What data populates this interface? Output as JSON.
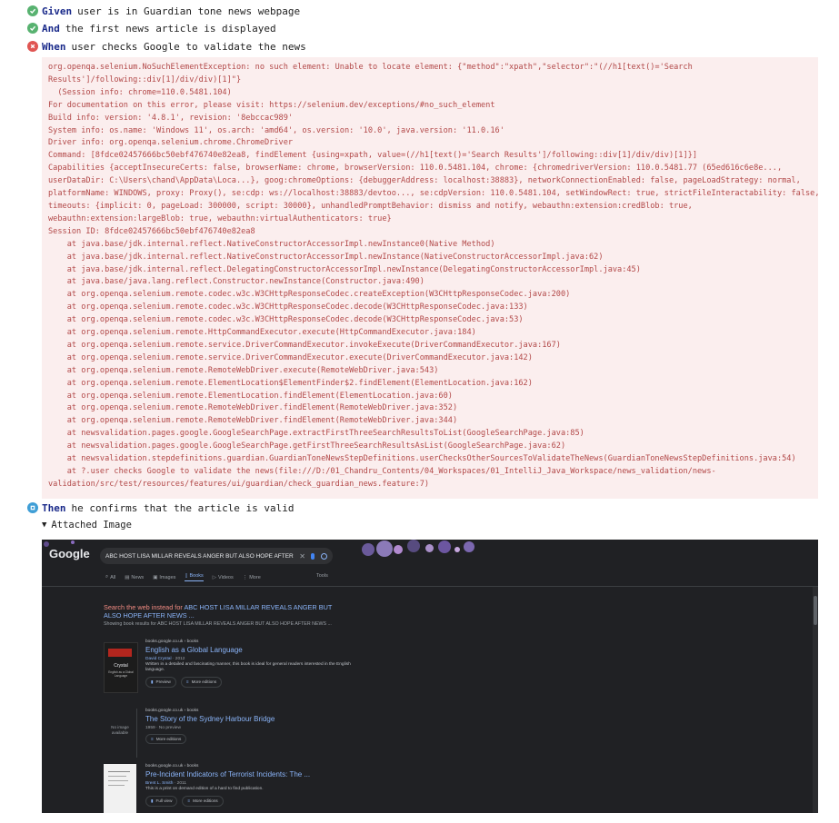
{
  "steps": [
    {
      "status": "pass",
      "keyword": "Given",
      "text": "user is in Guardian tone news webpage"
    },
    {
      "status": "pass",
      "keyword": "And",
      "text": "the first news article is displayed"
    },
    {
      "status": "fail",
      "keyword": "When",
      "text": "user checks Google to validate the news"
    },
    {
      "status": "info",
      "keyword": "Then",
      "text": "he confirms that the article is valid"
    }
  ],
  "error_lines": [
    "org.openqa.selenium.NoSuchElementException: no such element: Unable to locate element: {\"method\":\"xpath\",\"selector\":\"(//h1[text()='Search",
    "Results']/following::div[1]/div/div)[1]\"}",
    "  (Session info: chrome=110.0.5481.104)",
    "For documentation on this error, please visit: https://selenium.dev/exceptions/#no_such_element",
    "Build info: version: '4.8.1', revision: '8ebccac989'",
    "System info: os.name: 'Windows 11', os.arch: 'amd64', os.version: '10.0', java.version: '11.0.16'",
    "Driver info: org.openqa.selenium.chrome.ChromeDriver",
    "Command: [8fdce02457666bc50ebf476740e82ea8, findElement {using=xpath, value=(//h1[text()='Search Results']/following::div[1]/div/div)[1]}]",
    "Capabilities {acceptInsecureCerts: false, browserName: chrome, browserVersion: 110.0.5481.104, chrome: {chromedriverVersion: 110.0.5481.77 (65ed616c6e8e...,",
    "userDataDir: C:\\Users\\chand\\AppData\\Loca...}, goog:chromeOptions: {debuggerAddress: localhost:38883}, networkConnectionEnabled: false, pageLoadStrategy: normal,",
    "platformName: WINDOWS, proxy: Proxy(), se:cdp: ws://localhost:38883/devtoo..., se:cdpVersion: 110.0.5481.104, setWindowRect: true, strictFileInteractability: false,",
    "timeouts: {implicit: 0, pageLoad: 300000, script: 30000}, unhandledPromptBehavior: dismiss and notify, webauthn:extension:credBlob: true,",
    "webauthn:extension:largeBlob: true, webauthn:virtualAuthenticators: true}",
    "Session ID: 8fdce02457666bc50ebf476740e82ea8",
    "    at java.base/jdk.internal.reflect.NativeConstructorAccessorImpl.newInstance0(Native Method)",
    "    at java.base/jdk.internal.reflect.NativeConstructorAccessorImpl.newInstance(NativeConstructorAccessorImpl.java:62)",
    "    at java.base/jdk.internal.reflect.DelegatingConstructorAccessorImpl.newInstance(DelegatingConstructorAccessorImpl.java:45)",
    "    at java.base/java.lang.reflect.Constructor.newInstance(Constructor.java:490)",
    "    at org.openqa.selenium.remote.codec.w3c.W3CHttpResponseCodec.createException(W3CHttpResponseCodec.java:200)",
    "    at org.openqa.selenium.remote.codec.w3c.W3CHttpResponseCodec.decode(W3CHttpResponseCodec.java:133)",
    "    at org.openqa.selenium.remote.codec.w3c.W3CHttpResponseCodec.decode(W3CHttpResponseCodec.java:53)",
    "    at org.openqa.selenium.remote.HttpCommandExecutor.execute(HttpCommandExecutor.java:184)",
    "    at org.openqa.selenium.remote.service.DriverCommandExecutor.invokeExecute(DriverCommandExecutor.java:167)",
    "    at org.openqa.selenium.remote.service.DriverCommandExecutor.execute(DriverCommandExecutor.java:142)",
    "    at org.openqa.selenium.remote.RemoteWebDriver.execute(RemoteWebDriver.java:543)",
    "    at org.openqa.selenium.remote.ElementLocation$ElementFinder$2.findElement(ElementLocation.java:162)",
    "    at org.openqa.selenium.remote.ElementLocation.findElement(ElementLocation.java:60)",
    "    at org.openqa.selenium.remote.RemoteWebDriver.findElement(RemoteWebDriver.java:352)",
    "    at org.openqa.selenium.remote.RemoteWebDriver.findElement(RemoteWebDriver.java:344)",
    "    at newsvalidation.pages.google.GoogleSearchPage.extractFirstThreeSearchResultsToList(GoogleSearchPage.java:85)",
    "    at newsvalidation.pages.google.GoogleSearchPage.getFirstThreeSearchResultsAsList(GoogleSearchPage.java:62)",
    "    at newsvalidation.stepdefinitions.guardian.GuardianToneNewsStepDefinitions.userChecksOtherSourcesToValidateTheNews(GuardianToneNewsStepDefinitions.java:54)",
    "    at ?.user checks Google to validate the news(file:///D:/01_Chandru_Contents/04_Workspaces/01_IntelliJ_Java_Workspace/news_validation/news-",
    "validation/src/test/resources/features/ui/guardian/check_guardian_news.feature:7)"
  ],
  "attachment": {
    "label": "Attached Image"
  },
  "screenshot": {
    "logo": "Google",
    "query": "ABC HOST LISA MILLAR REVEALS ANGER BUT ALSO HOPE AFTER NE",
    "tabs": [
      {
        "label": "All",
        "active": false
      },
      {
        "label": "News",
        "active": false
      },
      {
        "label": "Images",
        "active": false
      },
      {
        "label": "Books",
        "active": true
      },
      {
        "label": "Videos",
        "active": false
      },
      {
        "label": "More",
        "active": false
      }
    ],
    "tools": "Tools",
    "suggest_prefix": "Search the web instead for ",
    "suggest_query": "ABC HOST LISA MILLAR REVEALS ANGER BUT ALSO HOPE AFTER NEWS ...",
    "showing": "Showing book results for ABC HOST LISA MILLAR REVEALS ANGER BUT ALSO HOPE AFTER NEWS ...",
    "results": [
      {
        "source": "books.google.co.uk › books",
        "title": "English as a Global Language",
        "author": "David Crystal",
        "year": "2012",
        "desc": "Written in a detailed and fascinating manner, this book is ideal for general readers interested in the English language.",
        "buttons": [
          "Preview",
          "More editions"
        ],
        "thumb_title": "Crystal",
        "thumb_sub": "English as a Global Language"
      },
      {
        "source": "books.google.co.uk › books",
        "title": "The Story of the Sydney Harbour Bridge",
        "author": "",
        "year": "1959 · No preview",
        "desc": "",
        "buttons": [
          "More editions"
        ],
        "thumb_title": "No image available",
        "thumb_sub": ""
      },
      {
        "source": "books.google.co.uk › books",
        "title": "Pre-Incident Indicators of Terrorist Incidents: The ...",
        "author": "Brent L. Smith",
        "year": "2011",
        "desc": "This is a print on demand edition of a hard to find publication.",
        "buttons": [
          "Full view",
          "More editions"
        ],
        "thumb_title": "",
        "thumb_sub": ""
      }
    ]
  },
  "colors": {
    "pass": "#58b270",
    "fail": "#e05552",
    "info": "#3f9ed6",
    "error_text": "#b24848",
    "error_bg": "#fbeeee"
  }
}
